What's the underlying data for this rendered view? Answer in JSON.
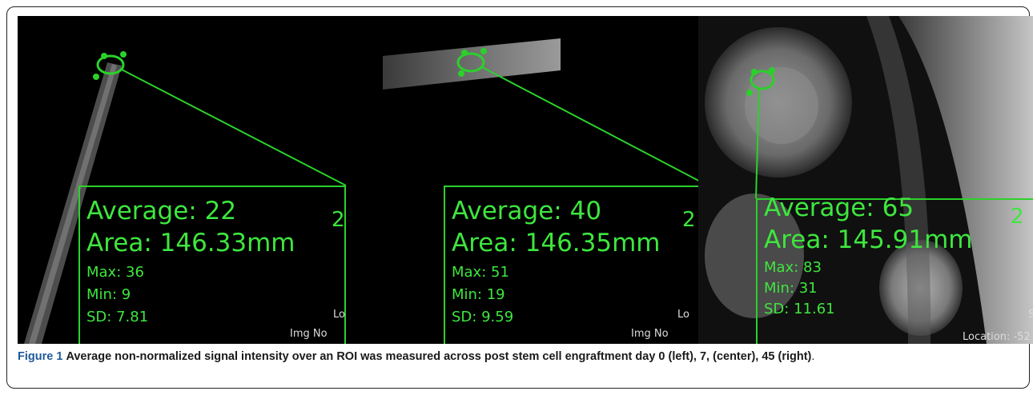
{
  "panels": [
    {
      "id": "day0",
      "average": "Average: 22",
      "area": "Area: 146.33mm",
      "area_sup": "2",
      "max": "Max: 36",
      "min": "Min: 9",
      "sd": "SD: 7.81",
      "corner_location": "Lo",
      "corner_img": "Img No"
    },
    {
      "id": "day7",
      "average": "Average: 40",
      "area": "Area: 146.35mm",
      "area_sup": "2",
      "max": "Max: 51",
      "min": "Min: 19",
      "sd": "SD: 9.59",
      "corner_location": "Lo",
      "corner_img": "Img No"
    },
    {
      "id": "day45",
      "average": "Average: 65",
      "area": "Area: 145.91mm",
      "area_sup": "2",
      "max": "Max: 83",
      "min": "Min: 31",
      "sd": "SD: 11.61",
      "corner_s": "S",
      "corner_location": "Location: -52"
    }
  ],
  "overlay_color": "#2bd12b",
  "caption": {
    "label": "Figure 1",
    "text": "Average non-normalized signal intensity over an ROI was measured across post stem cell engraftment day 0 (left), 7, (center), 45 (right)",
    "end": "."
  }
}
